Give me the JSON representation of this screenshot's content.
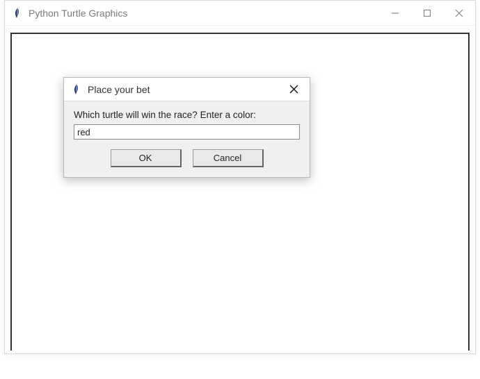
{
  "window": {
    "title": "Python Turtle Graphics"
  },
  "dialog": {
    "title": "Place your bet",
    "prompt": "Which turtle will win the race? Enter a color:",
    "input_value": "red",
    "ok_label": "OK",
    "cancel_label": "Cancel"
  },
  "icons": {
    "feather_color_dark": "#2b3a67",
    "feather_color_light": "#5a6fa8"
  }
}
